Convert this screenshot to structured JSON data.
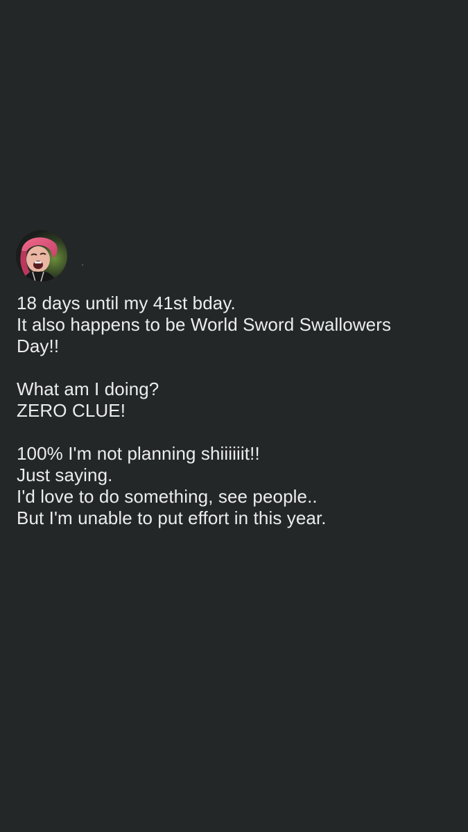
{
  "post": {
    "author_avatar": "profile-photo",
    "body_lines": [
      "18 days until my 41st bday.",
      "It also happens to be World Sword Swallowers",
      "Day!!",
      "",
      "What am I doing?",
      "ZERO CLUE!",
      "",
      "100% I'm not planning shiiiiiit!!",
      "Just saying.",
      "I'd love to do something, see people..",
      "But I'm unable to put effort in this year."
    ]
  },
  "colors": {
    "background": "#242728",
    "text": "#eceded"
  }
}
